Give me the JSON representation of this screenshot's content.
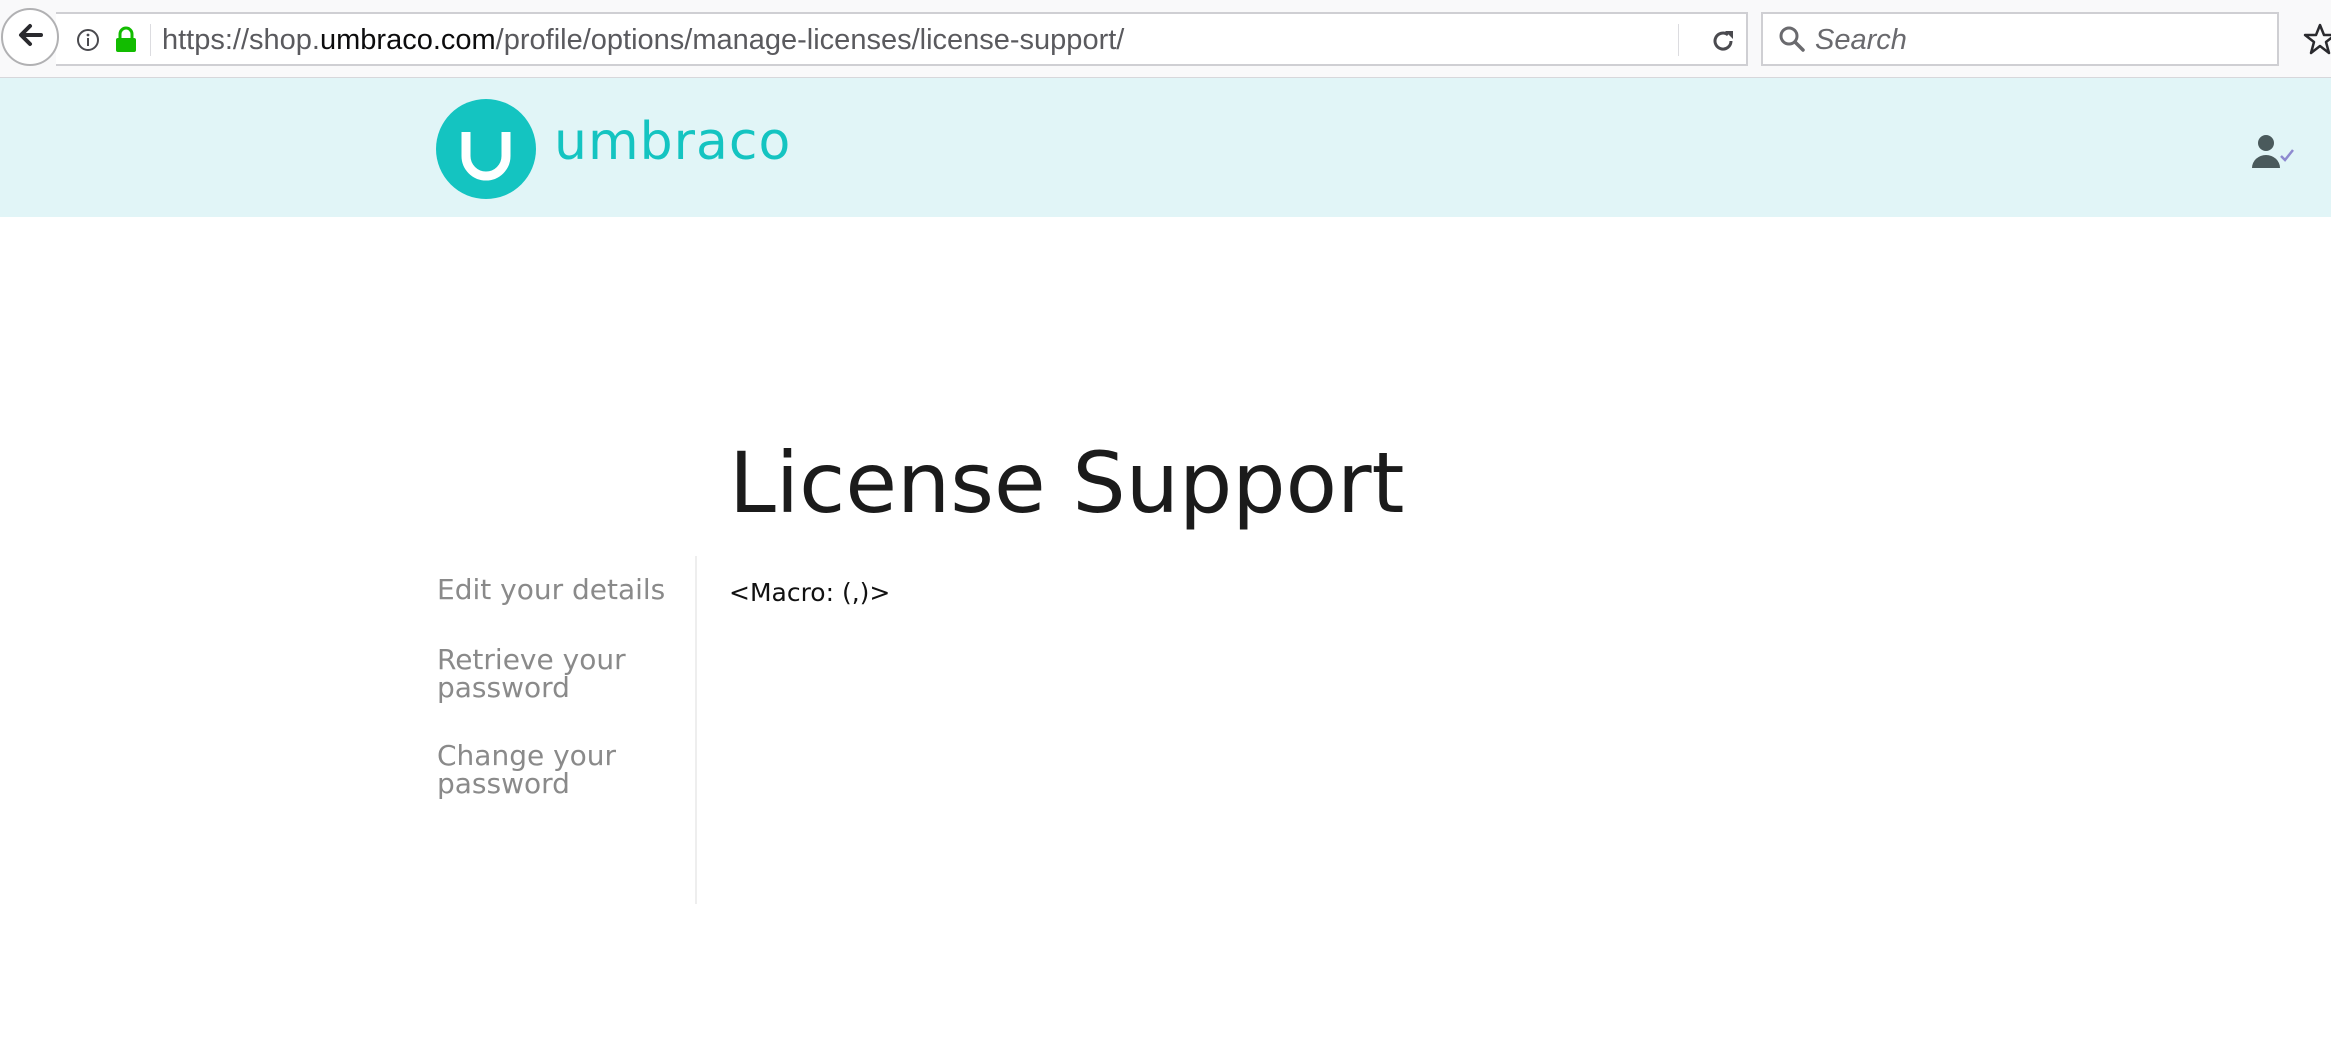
{
  "browser": {
    "url_prefix": "https://shop.",
    "url_host": "umbraco.com",
    "url_path": "/profile/options/manage-licenses/license-support/",
    "search_placeholder": "Search",
    "icons": [
      "back-arrow-icon",
      "info-icon",
      "lock-icon",
      "reload-icon",
      "search-icon",
      "star-icon"
    ]
  },
  "header": {
    "logo_text": "umbraco",
    "brand_color": "#14c4c1",
    "header_bg": "#e1f5f7",
    "icons": [
      "umbraco-logo-icon",
      "user-icon"
    ]
  },
  "main": {
    "title": "License Support",
    "content": "<Macro: (,)>"
  },
  "sidebar": {
    "items": [
      {
        "label": "Edit your details"
      },
      {
        "label": "Retrieve your password"
      },
      {
        "label": "Change your password"
      }
    ]
  }
}
